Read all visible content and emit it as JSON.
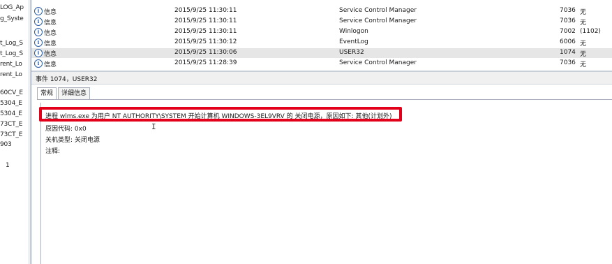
{
  "left_items": [
    "LOG_Ap",
    "g_Syste",
    "t_Log_S",
    "t_Log_S",
    "rent_Lo",
    "rent_Lo",
    "60CV_E",
    "5304_E",
    "5304_E",
    "73CT_E",
    "73CT_E",
    "903",
    "1"
  ],
  "events": [
    {
      "level": "信息",
      "datetime": "2015/9/25 11:30:11",
      "source": "Service Control Manager",
      "event_id": "7036",
      "category": "无"
    },
    {
      "level": "信息",
      "datetime": "2015/9/25 11:30:11",
      "source": "Service Control Manager",
      "event_id": "7036",
      "category": "无"
    },
    {
      "level": "信息",
      "datetime": "2015/9/25 11:30:11",
      "source": "Winlogon",
      "event_id": "7002",
      "category": "(1102)"
    },
    {
      "level": "信息",
      "datetime": "2015/9/25 11:30:12",
      "source": "EventLog",
      "event_id": "6006",
      "category": "无"
    },
    {
      "level": "信息",
      "datetime": "2015/9/25 11:30:06",
      "source": "USER32",
      "event_id": "1074",
      "category": "无"
    },
    {
      "level": "信息",
      "datetime": "2015/9/25 11:28:39",
      "source": "Service Control Manager",
      "event_id": "7036",
      "category": "无"
    }
  ],
  "detail": {
    "title": "事件 1074，USER32",
    "tabs": [
      "常规",
      "详细信息"
    ],
    "message": "进程 wlms.exe 为用户 NT AUTHORITY\\SYSTEM 开始计算机 WINDOWS-3EL9VRV 的 关闭电源，原因如下: 其他(计划外)",
    "reason_code": "原因代码: 0x0",
    "shutdown_type": "关机类型: 关闭电源",
    "comment": "注释:"
  },
  "colors": {
    "highlight": "#e3001b",
    "selected_row": "#e6e6e6",
    "info_icon": "#2d5fa8"
  },
  "icons": {
    "row_level": "info-icon",
    "cursor": "text-cursor-icon"
  }
}
